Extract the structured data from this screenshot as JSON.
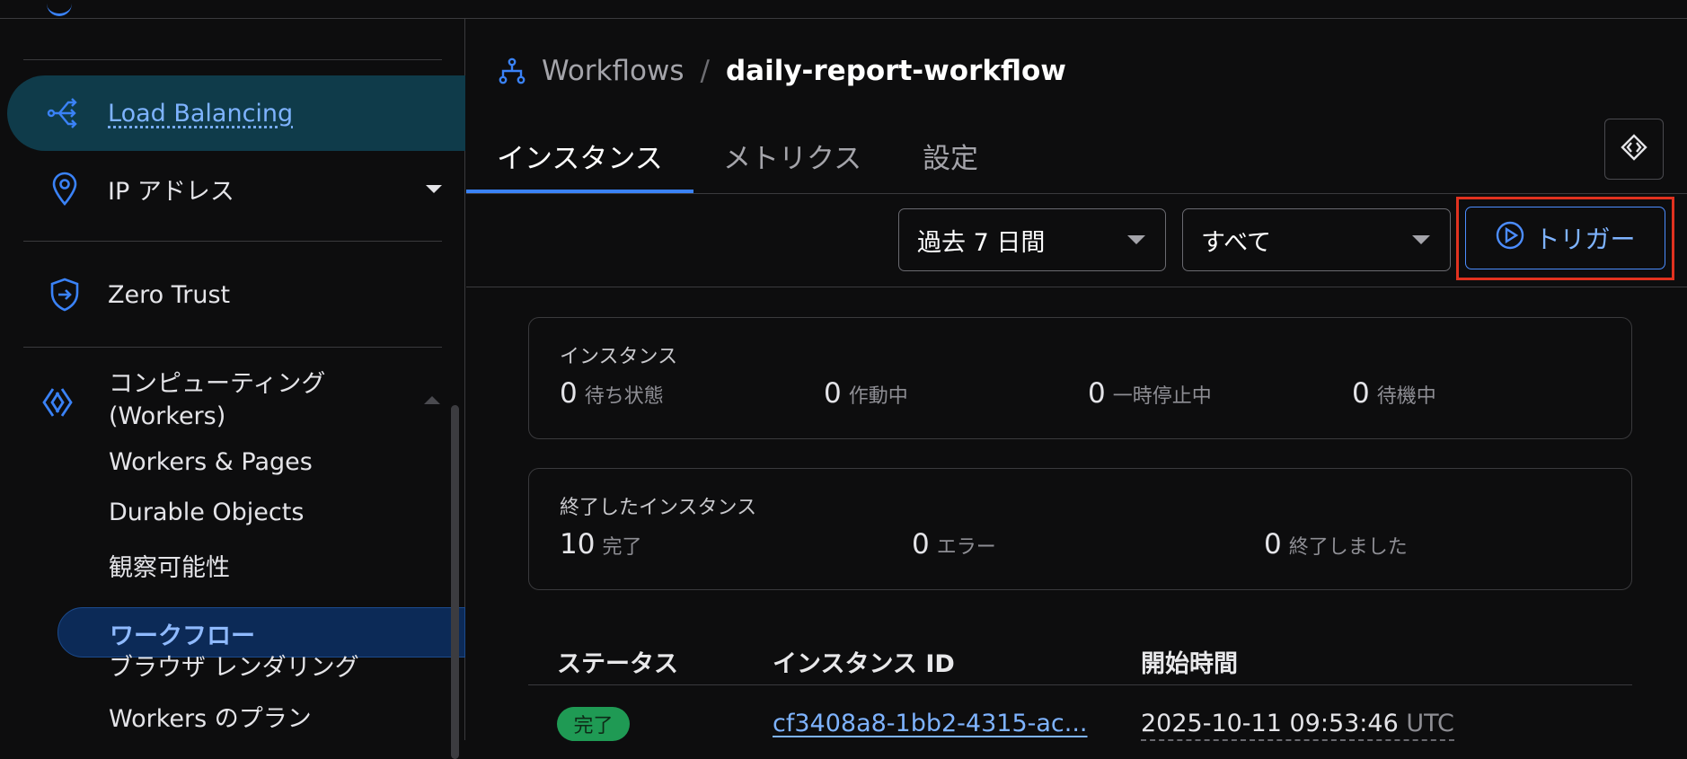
{
  "sidebar": {
    "load_balancing": "Load Balancing",
    "ip_address": "IP アドレス",
    "zero_trust": "Zero Trust",
    "computing_line1": "コンピューティング",
    "computing_line2": "(Workers)",
    "sub_items": {
      "workers_pages": "Workers & Pages",
      "durable_objects": "Durable Objects",
      "observability": "観察可能性",
      "workflows": "ワークフロー",
      "browser_rendering": "ブラウザ レンダリング",
      "workers_plans": "Workers のプラン"
    }
  },
  "breadcrumb": {
    "parent": "Workflows",
    "separator": "/",
    "current": "daily-report-workflow"
  },
  "tabs": {
    "instances": "インスタンス",
    "metrics": "メトリクス",
    "settings": "設定"
  },
  "filters": {
    "date_range": "過去 7 日間",
    "status": "すべて",
    "trigger": "トリガー"
  },
  "instances_card": {
    "title": "インスタンス",
    "queued_num": "0",
    "queued_label": "待ち状態",
    "running_num": "0",
    "running_label": "作動中",
    "paused_num": "0",
    "paused_label": "一時停止中",
    "waiting_num": "0",
    "waiting_label": "待機中"
  },
  "finished_card": {
    "title": "終了したインスタンス",
    "complete_num": "10",
    "complete_label": "完了",
    "error_num": "0",
    "error_label": "エラー",
    "terminated_num": "0",
    "terminated_label": "終了しました"
  },
  "table": {
    "headers": {
      "status": "ステータス",
      "instance_id": "インスタンス ID",
      "start_time": "開始時間"
    },
    "rows": [
      {
        "status": "完了",
        "instance_id": "cf3408a8-1bb2-4315-ac...",
        "start_time": "2025-10-11 09:53:46",
        "timezone": "UTC"
      }
    ]
  },
  "colors": {
    "accent": "#3a82f7",
    "link": "#7eb3ff",
    "success": "#1f9a54",
    "highlight": "#e1321f"
  }
}
